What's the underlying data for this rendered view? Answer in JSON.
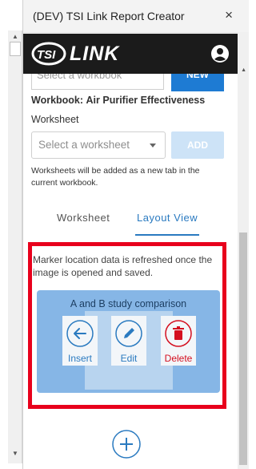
{
  "window": {
    "title": "(DEV) TSI Link Report Creator",
    "close_label": "×"
  },
  "banner": {
    "brand": "TSI",
    "product": "LINK"
  },
  "workbook": {
    "select_placeholder": "Select a workbook",
    "new_label": "NEW",
    "label": "Workbook:",
    "name": "Air Purifier Effectiveness"
  },
  "worksheet": {
    "label": "Worksheet",
    "select_placeholder": "Select a worksheet",
    "add_label": "ADD",
    "hint": "Worksheets will be added as a new tab in the current workbook."
  },
  "tabs": [
    {
      "label": "Worksheet",
      "active": false
    },
    {
      "label": "Layout View",
      "active": true
    }
  ],
  "layout": {
    "note": "Marker location data is refreshed once the image is opened and saved.",
    "card_title": "A and B study comparison",
    "actions": {
      "insert": "Insert",
      "edit": "Edit",
      "delete": "Delete"
    }
  },
  "colors": {
    "primary": "#1e7bd3",
    "highlight_frame": "#e8001c",
    "card_bg": "#86b6e6",
    "delete": "#d40f1f"
  },
  "icons": [
    "close-icon",
    "tsi-logo-icon",
    "user-account-icon",
    "arrow-left-icon",
    "pencil-icon",
    "trash-icon",
    "plus-icon",
    "chevron-down-icon"
  ]
}
